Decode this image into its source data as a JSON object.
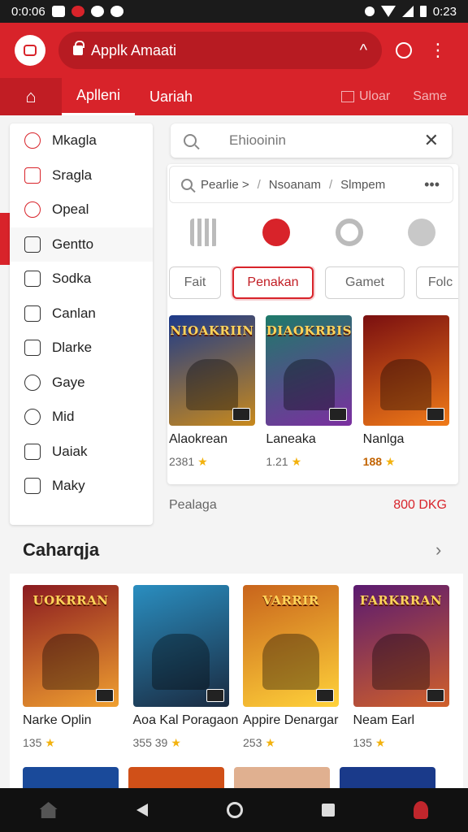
{
  "status_bar": {
    "time_left": "0:0:06",
    "time_right": "0:23"
  },
  "app_bar": {
    "url_text": "Applk Amaati",
    "expand_glyph": "^",
    "more_glyph": "⋮"
  },
  "tabs": {
    "home_glyph": "⌂",
    "items": [
      "Aplleni",
      "Uariah"
    ],
    "right": [
      "Uloar",
      "Same"
    ]
  },
  "sidebar": {
    "items": [
      {
        "label": "Mkagla",
        "icon": "search-icon"
      },
      {
        "label": "Sragla",
        "icon": "grid-icon"
      },
      {
        "label": "Opeal",
        "icon": "pin-icon"
      },
      {
        "label": "Gentto",
        "icon": "bag-icon"
      },
      {
        "label": "Sodka",
        "icon": "square-icon"
      },
      {
        "label": "Canlan",
        "icon": "camera-icon"
      },
      {
        "label": "Dlarke",
        "icon": "pen-icon"
      },
      {
        "label": "Gaye",
        "icon": "coin-icon"
      },
      {
        "label": "Mid",
        "icon": "search-icon"
      },
      {
        "label": "Uaiak",
        "icon": "doc-icon"
      },
      {
        "label": "Maky",
        "icon": "doc-icon"
      }
    ]
  },
  "search": {
    "placeholder": "Ehiooinin",
    "clear_glyph": "✕"
  },
  "breadcrumbs": {
    "items": [
      "Pearlie >",
      "Nsoanam",
      "Slmpem"
    ],
    "more": "•••",
    "sep": "/"
  },
  "chips": [
    "Fait",
    "Penakan",
    "Gamet",
    "Folc"
  ],
  "mini_games": [
    {
      "title": "Alaokrean",
      "rating": "2381",
      "cover_text": "NIOAKRIIN",
      "c1": "#1c3a8a",
      "c2": "#c8891c"
    },
    {
      "title": "Laneaka",
      "rating": "1.21",
      "cover_text": "DIAOKRBIS",
      "c1": "#1e7a6a",
      "c2": "#7b2fa0"
    },
    {
      "title": "Nanlga",
      "rating": "188",
      "cover_text": "",
      "c1": "#7a0f10",
      "c2": "#f07a18"
    }
  ],
  "stats": {
    "label": "Pealaga",
    "value": "800 DKG"
  },
  "section": {
    "title": "Caharqja",
    "chevron": "›"
  },
  "big_games": [
    {
      "title": "Narke Oplin",
      "rating": "135",
      "cover_text": "UOKRRAN",
      "c1": "#8a1a20",
      "c2": "#f0a030"
    },
    {
      "title": "Aoa Kal Poragaon",
      "rating": "355 39",
      "cover_text": "",
      "c1": "#2a8ec0",
      "c2": "#1a2a40"
    },
    {
      "title": "Appire Denargar",
      "rating": "253",
      "cover_text": "VARRIR",
      "c1": "#c8641c",
      "c2": "#ffd23a"
    },
    {
      "title": "Neam Earl",
      "rating": "135",
      "cover_text": "FARKRRAN",
      "c1": "#5a1a70",
      "c2": "#d0602a"
    }
  ],
  "row3_colors": [
    "#1a4a9a",
    "#d05018",
    "#e0b090",
    "#1a3a8a"
  ],
  "colors": {
    "accent": "#d8232a",
    "star": "#f3b20e"
  }
}
